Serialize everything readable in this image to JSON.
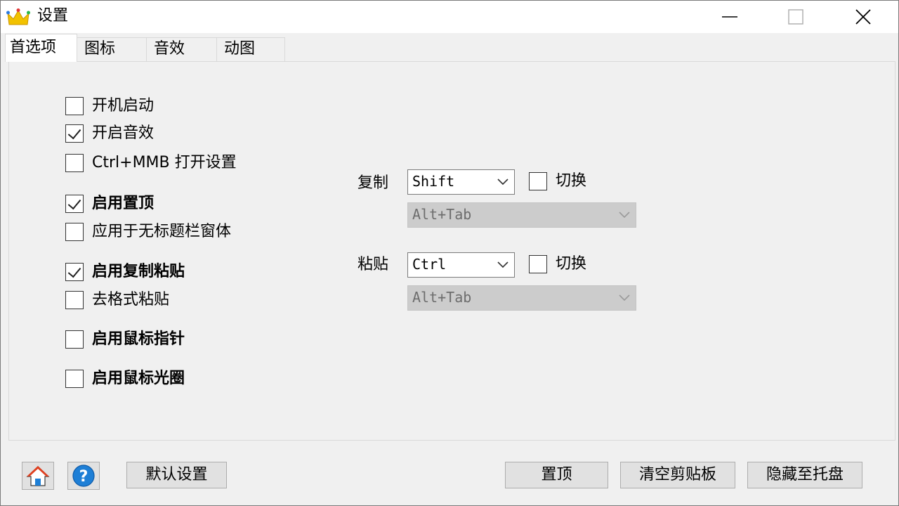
{
  "window": {
    "title": "设置"
  },
  "tabs": [
    {
      "label": "首选项",
      "active": true
    },
    {
      "label": "图标",
      "active": false
    },
    {
      "label": "音效",
      "active": false
    },
    {
      "label": "动图",
      "active": false
    }
  ],
  "options": [
    {
      "label": "开机启动",
      "checked": false,
      "bold": false
    },
    {
      "label": "开启音效",
      "checked": true,
      "bold": false
    },
    {
      "label": "Ctrl+MMB 打开设置",
      "checked": false,
      "bold": false
    },
    {
      "label": "启用置顶",
      "checked": true,
      "bold": true
    },
    {
      "label": "应用于无标题栏窗体",
      "checked": false,
      "bold": false
    },
    {
      "label": "启用复制粘贴",
      "checked": true,
      "bold": true
    },
    {
      "label": "去格式粘贴",
      "checked": false,
      "bold": false
    },
    {
      "label": "启用鼠标指针",
      "checked": false,
      "bold": true
    },
    {
      "label": "启用鼠标光圈",
      "checked": false,
      "bold": true
    }
  ],
  "hotkeys": {
    "copy": {
      "label": "复制",
      "modifier": "Shift",
      "toggle_label": "切换",
      "toggle_checked": false,
      "combo": "Alt+Tab"
    },
    "paste": {
      "label": "粘贴",
      "modifier": "Ctrl",
      "toggle_label": "切换",
      "toggle_checked": false,
      "combo": "Alt+Tab"
    }
  },
  "buttons": {
    "defaults": "默认设置",
    "pin": "置顶",
    "clear_clipboard": "清空剪贴板",
    "hide_to_tray": "隐藏至托盘"
  },
  "icons": {
    "app": "crown-icon",
    "home": "home-icon",
    "help": "help-icon"
  },
  "colors": {
    "accent_blue": "#1e7fd6",
    "home_roof": "#e04020"
  }
}
